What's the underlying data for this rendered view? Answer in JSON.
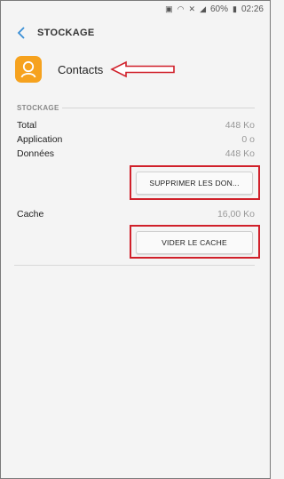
{
  "status": {
    "battery": "60%",
    "time": "02:26"
  },
  "app_bar": {
    "title": "STOCKAGE"
  },
  "app_header": {
    "name": "Contacts"
  },
  "storage": {
    "section_label": "STOCKAGE",
    "rows": [
      {
        "label": "Total",
        "value": "448 Ko"
      },
      {
        "label": "Application",
        "value": "0 o"
      },
      {
        "label": "Données",
        "value": "448 Ko"
      }
    ],
    "clear_data_button": "SUPPRIMER LES DON..."
  },
  "cache": {
    "label": "Cache",
    "value": "16,00 Ko",
    "clear_cache_button": "VIDER LE CACHE"
  },
  "colors": {
    "app_icon": "#f6a21e",
    "accent": "#3a8fd6",
    "highlight": "#d0202a"
  }
}
